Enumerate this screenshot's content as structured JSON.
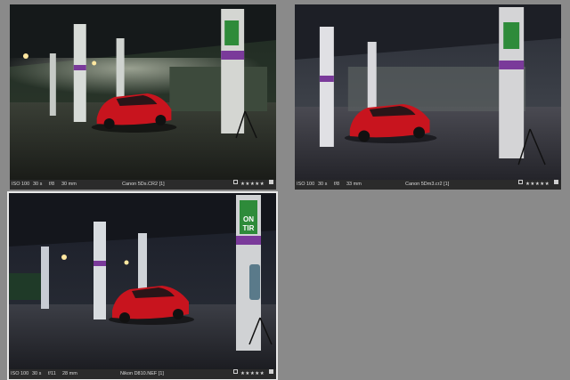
{
  "photos": [
    {
      "iso": "ISO 100",
      "shutter": "30 s",
      "aperture": "f/8",
      "focal": "30 mm",
      "filename": "Canon 5Ds.CR2 [1]",
      "rating_stars": "★★★★★",
      "selected": false
    },
    {
      "iso": "ISO 100",
      "shutter": "30 s",
      "aperture": "f/8",
      "focal": "33 mm",
      "filename": "Canon 5Dm3.cr2 [1]",
      "rating_stars": "★★★★★",
      "selected": false
    },
    {
      "iso": "ISO 100",
      "shutter": "30 s",
      "aperture": "f/11",
      "focal": "28 mm",
      "filename": "Nikon D810.NEF [1]",
      "rating_stars": "★★★★★",
      "selected": true
    }
  ],
  "sign_text": {
    "line1": "ON",
    "line2": "TIR"
  },
  "colors": {
    "background": "#8a8a8a",
    "car": "#c8141e",
    "pillar_accent": "#7a3a9a",
    "sign_green": "#2e8b3a"
  }
}
